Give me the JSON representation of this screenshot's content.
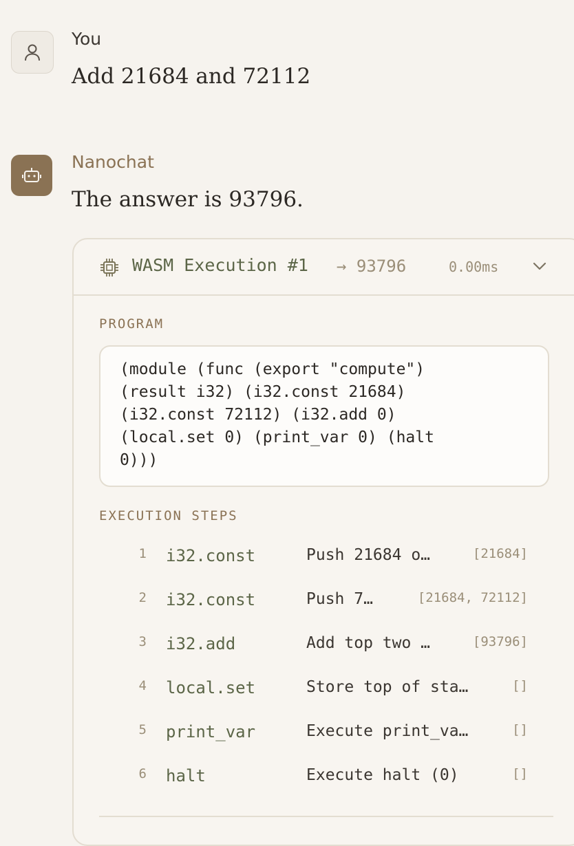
{
  "user": {
    "name": "You",
    "message": "Add 21684 and 72112",
    "icon": "user-icon"
  },
  "bot": {
    "name": "Nanochat",
    "message": "The answer is 93796.",
    "icon": "robot-icon"
  },
  "execution": {
    "title": "WASM Execution #1",
    "result": "→ 93796",
    "time": "0.00ms",
    "icon": "chip-icon",
    "program_label": "PROGRAM",
    "program_lines": [
      "(module (func (export \"compute\")",
      "(result i32) (i32.const 21684)",
      "(i32.const 72112) (i32.add 0)",
      "(local.set 0) (print_var 0) (halt",
      "0)))"
    ],
    "steps_label": "EXECUTION STEPS",
    "steps": [
      {
        "num": "1",
        "op": "i32.const",
        "desc": "Push 21684 o…",
        "stack": "[21684]"
      },
      {
        "num": "2",
        "op": "i32.const",
        "desc": "Push 7…",
        "stack": "[21684, 72112]"
      },
      {
        "num": "3",
        "op": "i32.add",
        "desc": "Add top two …",
        "stack": "[93796]"
      },
      {
        "num": "4",
        "op": "local.set",
        "desc": "Store top of sta…",
        "stack": "[]"
      },
      {
        "num": "5",
        "op": "print_var",
        "desc": "Execute print_va…",
        "stack": "[]"
      },
      {
        "num": "6",
        "op": "halt",
        "desc": "Execute halt (0)",
        "stack": "[]"
      }
    ]
  },
  "colors": {
    "background": "#f6f3ee",
    "accent_brown": "#8a7254",
    "opcode_green": "#5c6648",
    "muted": "#9a8e78"
  }
}
